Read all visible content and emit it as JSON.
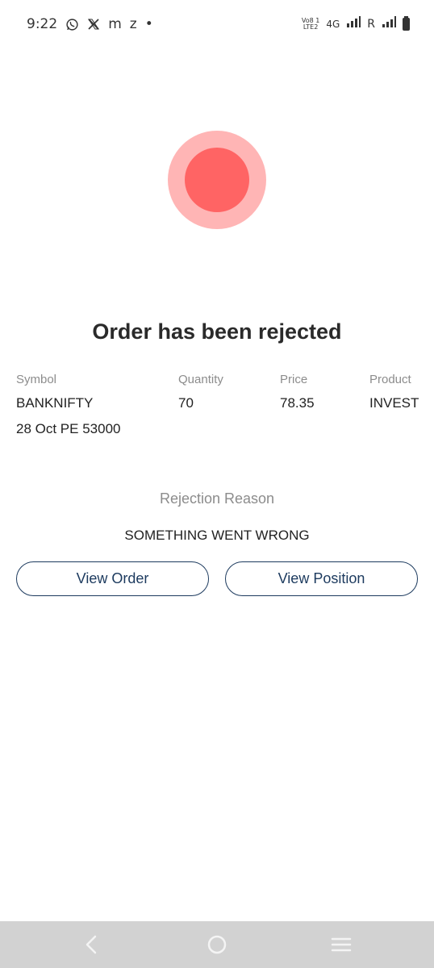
{
  "status_bar": {
    "time": "9:22",
    "left_icons": [
      "whatsapp-icon",
      "x-icon",
      "m-icon",
      "z-icon",
      "dot-icon"
    ],
    "m_glyph": "m",
    "z_glyph": "z",
    "dot_glyph": "•",
    "volte_top": "Vo8 1",
    "volte_bottom": "LTE2",
    "network": "4G",
    "roaming": "R"
  },
  "order": {
    "title": "Order has been rejected",
    "status_colors": {
      "outer": "#ffb5b5",
      "inner": "#ff6464"
    },
    "columns": {
      "symbol_label": "Symbol",
      "quantity_label": "Quantity",
      "price_label": "Price",
      "product_label": "Product"
    },
    "values": {
      "symbol": "BANKNIFTY",
      "symbol_detail": "28 Oct PE 53000",
      "quantity": "70",
      "price": "78.35",
      "product": "INVEST"
    },
    "rejection_reason_label": "Rejection Reason",
    "rejection_reason": "SOMETHING WENT WRONG"
  },
  "actions": {
    "view_order": "View Order",
    "view_position": "View Position",
    "accent_color": "#1c3a5e"
  },
  "nav_bar": {
    "icons": [
      "back-icon",
      "home-icon",
      "recents-icon"
    ]
  }
}
